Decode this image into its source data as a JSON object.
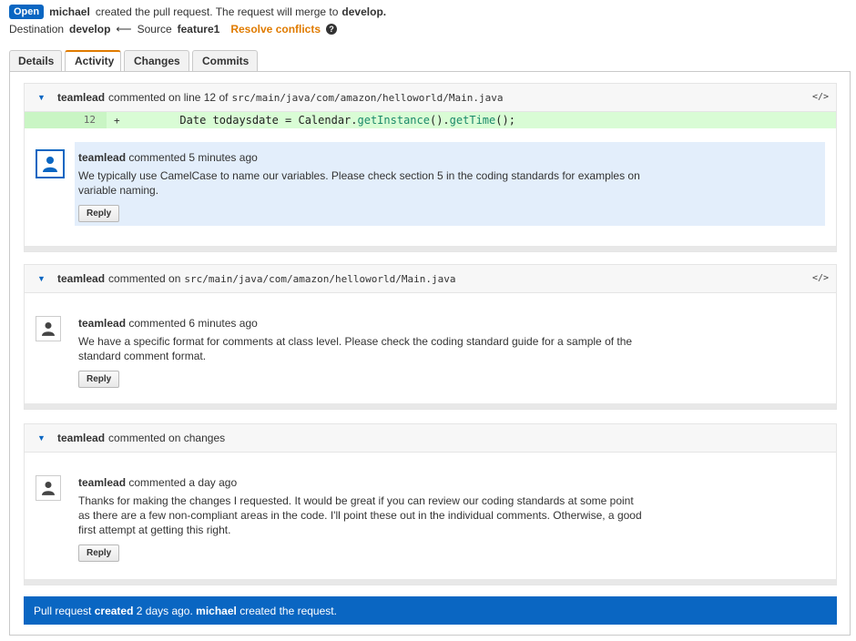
{
  "header": {
    "status_badge": "Open",
    "author": "michael",
    "created_text": "created the pull request. The request will merge to",
    "target_branch": "develop.",
    "destination_label": "Destination",
    "destination_branch": "develop",
    "arrow": "⟵",
    "source_label": "Source",
    "source_branch": "feature1",
    "resolve_conflicts": "Resolve conflicts",
    "help_icon": "?"
  },
  "tabs": [
    {
      "label": "Details"
    },
    {
      "label": "Activity",
      "active": true
    },
    {
      "label": "Changes"
    },
    {
      "label": "Commits"
    }
  ],
  "threads": [
    {
      "head_user": "teamlead",
      "head_text": "commented on line 12 of",
      "head_path": "src/main/java/com/amazon/helloworld/Main.java",
      "code_icon": "</>",
      "diff": {
        "line_number": "12",
        "marker": "+",
        "code_before": "        Date todaysdate = Calendar.",
        "code_m1": "getInstance",
        "code_mid": "().",
        "code_m2": "getTime",
        "code_after": "();"
      },
      "comment": {
        "user": "teamlead",
        "meta": "commented 5 minutes ago",
        "text": "We typically use CamelCase to name our variables. Please check section 5 in the coding standards for examples on variable naming.",
        "reply": "Reply"
      }
    },
    {
      "head_user": "teamlead",
      "head_text": "commented on",
      "head_path": "src/main/java/com/amazon/helloworld/Main.java",
      "code_icon": "</>",
      "comment": {
        "user": "teamlead",
        "meta": "commented 6 minutes ago",
        "text": "We have a specific format for comments at class level. Please check the coding standard guide for a sample of the standard comment format.",
        "reply": "Reply"
      }
    },
    {
      "head_user": "teamlead",
      "head_text": "commented on changes",
      "comment": {
        "user": "teamlead",
        "meta": "commented a day ago",
        "text": "Thanks for making the changes I requested. It would be great if you can review our coding standards at some point as there are a few non-compliant areas in the code. I'll point these out in the individual comments. Otherwise, a good first attempt at getting this right.",
        "reply": "Reply"
      }
    }
  ],
  "footer": {
    "prefix": "Pull request",
    "created": "created",
    "when": "2 days ago.",
    "user": "michael",
    "suffix": "created the request."
  },
  "icons": {
    "caret": "caret-down-icon",
    "avatar": "user-silhouette-icon",
    "code": "code-icon"
  },
  "colors": {
    "accent_blue": "#0a66c2",
    "resolve_orange": "#e07b00",
    "diff_add_bg": "#d9fcd5",
    "highlight_bg": "#e3eefb"
  }
}
